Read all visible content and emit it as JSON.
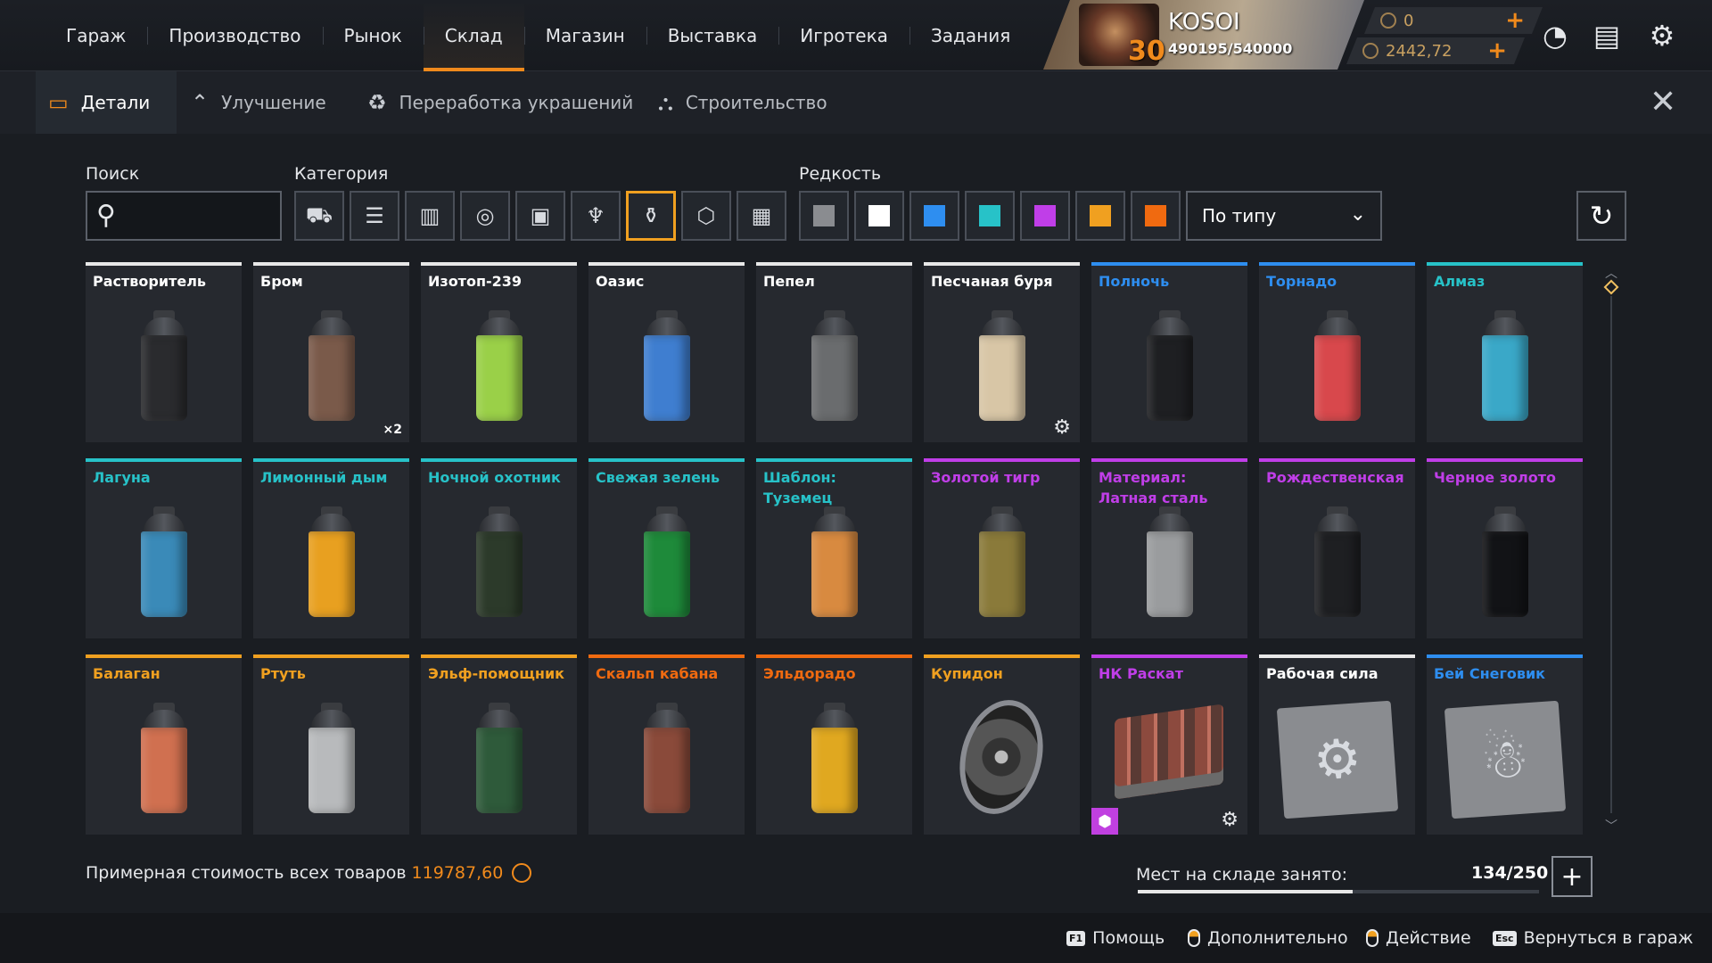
{
  "nav": {
    "items": [
      {
        "label": "Гараж"
      },
      {
        "label": "Производство"
      },
      {
        "label": "Рынок"
      },
      {
        "label": "Склад"
      },
      {
        "label": "Магазин"
      },
      {
        "label": "Выставка"
      },
      {
        "label": "Игротека"
      },
      {
        "label": "Задания"
      }
    ],
    "active": "Склад"
  },
  "player": {
    "name": "KOSOI",
    "level": "30",
    "xp": "490195/540000"
  },
  "currency": {
    "coupons": "0",
    "crowns": "2442,72"
  },
  "subtabs": [
    {
      "label": "Детали"
    },
    {
      "label": "Улучшение"
    },
    {
      "label": "Переработка украшений"
    },
    {
      "label": "Строительство"
    }
  ],
  "filters": {
    "search_label": "Поиск",
    "search_value": "",
    "category_label": "Категория",
    "rarity_label": "Редкость",
    "rarity_colors": [
      "#8a8c90",
      "#ffffff",
      "#2e8ef0",
      "#27c2c8",
      "#c03ee8",
      "#f0a020",
      "#f06a10"
    ],
    "sort_value": "По типу"
  },
  "items": [
    {
      "name": "Растворитель",
      "rarity": "#e8e8e8",
      "visual": "can",
      "color": "#2a2b2e"
    },
    {
      "name": "Бром",
      "rarity": "#e8e8e8",
      "visual": "can",
      "color": "#7a5a4a",
      "qty": "×2"
    },
    {
      "name": "Изотоп-239",
      "rarity": "#e8e8e8",
      "visual": "can",
      "color": "#9ad048"
    },
    {
      "name": "Оазис",
      "rarity": "#e8e8e8",
      "visual": "can",
      "color": "#3f7ed0"
    },
    {
      "name": "Пепел",
      "rarity": "#e8e8e8",
      "visual": "can",
      "color": "#6a6c6e"
    },
    {
      "name": "Песчаная буря",
      "rarity": "#e8e8e8",
      "visual": "can",
      "color": "#d8c6a6",
      "gear": true
    },
    {
      "name": "Полночь",
      "rarity": "#2e8ef0",
      "visual": "can",
      "color": "#1e1f22"
    },
    {
      "name": "Торнадо",
      "rarity": "#2e8ef0",
      "visual": "can",
      "color": "#d8484c"
    },
    {
      "name": "Алмаз",
      "rarity": "#27c2c8",
      "visual": "can",
      "color": "#3aa8c8"
    },
    {
      "name": "Лагуна",
      "rarity": "#27c2c8",
      "visual": "can",
      "color": "#3a8ab8"
    },
    {
      "name": "Лимонный дым",
      "rarity": "#27c2c8",
      "visual": "can",
      "color": "#e8a020"
    },
    {
      "name": "Ночной охотник",
      "rarity": "#27c2c8",
      "visual": "can",
      "color": "#2c3a2a"
    },
    {
      "name": "Свежая зелень",
      "rarity": "#27c2c8",
      "visual": "can",
      "color": "#1e8a3a"
    },
    {
      "name": "Шаблон: Туземец",
      "rarity": "#27c2c8",
      "visual": "can",
      "color": "#d88a40"
    },
    {
      "name": "Золотой тигр",
      "rarity": "#c03ee8",
      "visual": "can",
      "color": "#8a7a3a"
    },
    {
      "name": "Материал: Латная сталь",
      "rarity": "#c03ee8",
      "visual": "can",
      "color": "#9a9c9e"
    },
    {
      "name": "Рождественская",
      "rarity": "#c03ee8",
      "visual": "can",
      "color": "#1e1f22"
    },
    {
      "name": "Черное золото",
      "rarity": "#c03ee8",
      "visual": "can",
      "color": "#121316"
    },
    {
      "name": "Балаган",
      "rarity": "#f0a020",
      "visual": "can",
      "color": "#d07050"
    },
    {
      "name": "Ртуть",
      "rarity": "#f0a020",
      "visual": "can",
      "color": "#b8babc"
    },
    {
      "name": "Эльф-помощник",
      "rarity": "#f0a020",
      "visual": "can",
      "color": "#2e5a3a"
    },
    {
      "name": "Скальп кабана",
      "rarity": "#f06a10",
      "visual": "can",
      "color": "#8a4a3a"
    },
    {
      "name": "Эльдорадо",
      "rarity": "#f06a10",
      "visual": "can",
      "color": "#e0a820"
    },
    {
      "name": "Купидон",
      "rarity": "#f0a020",
      "visual": "wheel"
    },
    {
      "name": "НК Раскат",
      "rarity": "#c03ee8",
      "visual": "engine",
      "gear": true,
      "badge": true
    },
    {
      "name": "Рабочая сила",
      "rarity": "#e8e8e8",
      "visual": "sticker",
      "icon": "⚙"
    },
    {
      "name": "Бей Снеговик",
      "rarity": "#2e8ef0",
      "visual": "sticker",
      "icon": "☃"
    }
  ],
  "footer": {
    "value_label": "Примерная стоимость всех товаров",
    "value": "119787,60",
    "storage_label": "Мест на складе занято:",
    "storage_count": "134/250",
    "storage_fraction": 0.536
  },
  "hints": [
    {
      "key": "F1",
      "label": "Помощь"
    },
    {
      "key": "mouse",
      "label": "Дополнительно"
    },
    {
      "key": "mouse",
      "label": "Действие"
    },
    {
      "key": "Esc",
      "label": "Вернуться в гараж"
    }
  ]
}
